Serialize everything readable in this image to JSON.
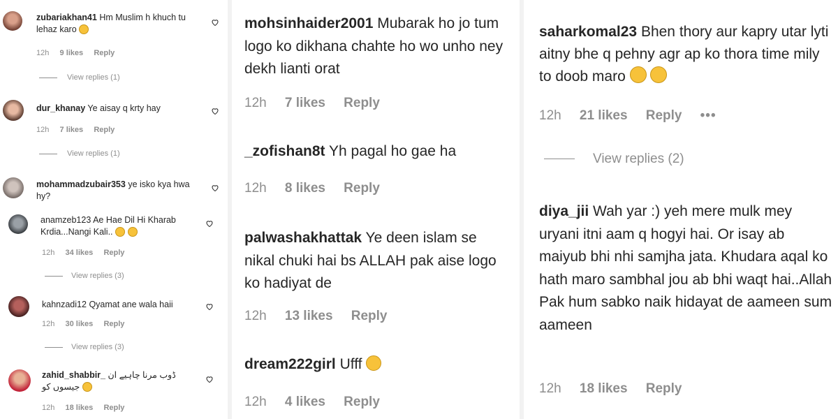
{
  "panel1": {
    "comments": [
      {
        "username": "zubariakhan41",
        "text": "Hm Muslim h khuch tu lehaz karo",
        "emoji": "sad-face",
        "time": "12h",
        "likes": "9 likes",
        "reply": "Reply",
        "view_replies": "View replies (1)"
      },
      {
        "username": "dur_khanay",
        "text": "Ye aisay q krty hay",
        "time": "12h",
        "likes": "7 likes",
        "reply": "Reply",
        "view_replies": "View replies (1)"
      },
      {
        "username": "mohammadzubair353",
        "text": "ye isko kya hwa hy?"
      },
      {
        "username": "anamzeb123",
        "text": "Ae Hae Dil Hi Kharab Krdia...Nangi Kali..",
        "emoji": "crying-faces",
        "time": "12h",
        "likes": "34 likes",
        "reply": "Reply",
        "view_replies": "View replies (3)"
      },
      {
        "username": "kahnzadi12",
        "text": "Qyamat ane wala haii",
        "time": "12h",
        "likes": "30 likes",
        "reply": "Reply",
        "view_replies": "View replies (3)"
      },
      {
        "username": "zahid_shabbir_",
        "text": "ڈوب مرنا چاہیے ان جیسوں کو",
        "emoji": "screaming-face",
        "time": "12h",
        "likes": "18 likes",
        "reply": "Reply"
      }
    ]
  },
  "panel2": {
    "comments": [
      {
        "username": "mohsinhaider2001",
        "text": "Mubarak ho jo tum logo ko dikhana chahte ho wo unho ney dekh lianti orat",
        "time": "12h",
        "likes": "7 likes",
        "reply": "Reply"
      },
      {
        "username": "_zofishan8t",
        "text": "Yh pagal ho gae ha",
        "time": "12h",
        "likes": "8 likes",
        "reply": "Reply"
      },
      {
        "username": "palwashakhattak",
        "text": "Ye deen islam se nikal chuki hai bs ALLAH pak aise logo ko hadiyat de",
        "time": "12h",
        "likes": "13 likes",
        "reply": "Reply"
      },
      {
        "username": "dream222girl",
        "text": "Ufff",
        "emoji": "sad-face",
        "time": "12h",
        "likes": "4 likes",
        "reply": "Reply"
      }
    ]
  },
  "panel3": {
    "comments": [
      {
        "username": "saharkomal23",
        "text": "Bhen thory aur kapry utar lyti aitny bhe q pehny agr ap ko thora time mily to doob maro",
        "emoji": "smirk-faces",
        "time": "12h",
        "likes": "21 likes",
        "reply": "Reply",
        "more": "•••",
        "view_replies": "View replies (2)"
      },
      {
        "username": "diya_jii",
        "text": "Wah yar :) yeh mere mulk mey uryani itni aam q hogyi hai. Or isay ab maiyub bhi nhi samjha jata. Khudara aqal ko hath maro sambhal jou ab bhi waqt hai..Allah Pak hum sabko naik hidayat de aameen sum aameen",
        "time": "12h",
        "likes": "18 likes",
        "reply": "Reply"
      }
    ]
  },
  "colors": {
    "text": "#262626",
    "meta": "#8e8e8e",
    "emoji": "#f7c23a"
  }
}
